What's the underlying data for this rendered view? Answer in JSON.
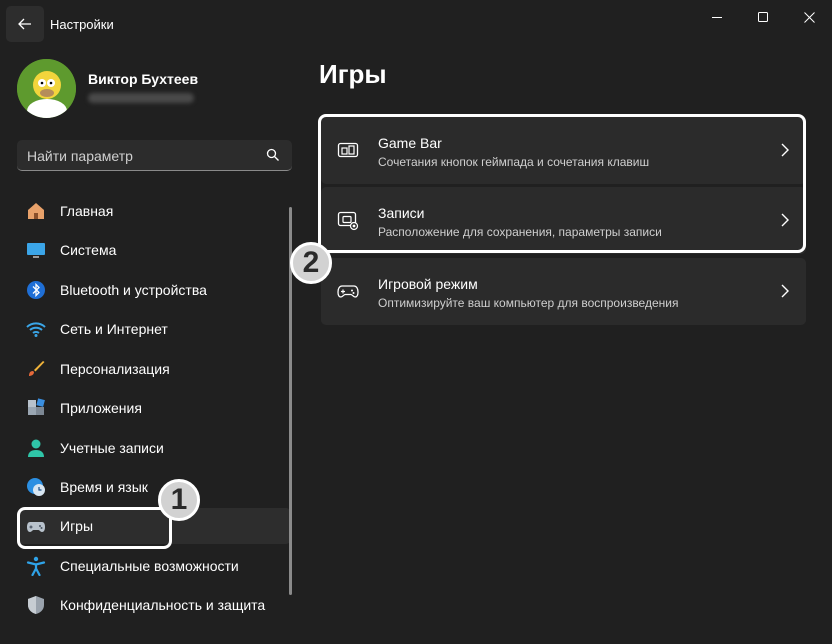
{
  "window": {
    "title": "Настройки"
  },
  "profile": {
    "name": "Виктор Бухтеев"
  },
  "search": {
    "placeholder": "Найти параметр"
  },
  "sidebar": {
    "items": [
      {
        "label": "Главная",
        "icon": "home-icon"
      },
      {
        "label": "Система",
        "icon": "monitor-icon"
      },
      {
        "label": "Bluetooth и устройства",
        "icon": "bluetooth-icon"
      },
      {
        "label": "Сеть и Интернет",
        "icon": "wifi-icon"
      },
      {
        "label": "Персонализация",
        "icon": "brush-icon"
      },
      {
        "label": "Приложения",
        "icon": "apps-icon"
      },
      {
        "label": "Учетные записи",
        "icon": "person-icon"
      },
      {
        "label": "Время и язык",
        "icon": "globe-clock-icon"
      },
      {
        "label": "Игры",
        "icon": "gamepad-icon",
        "selected": true
      },
      {
        "label": "Специальные возможности",
        "icon": "accessibility-icon"
      },
      {
        "label": "Конфиденциальность и защита",
        "icon": "shield-icon"
      }
    ]
  },
  "main": {
    "title": "Игры",
    "cards": [
      {
        "title": "Game Bar",
        "subtitle": "Сочетания кнопок геймпада и сочетания клавиш",
        "icon": "game-bar-icon"
      },
      {
        "title": "Записи",
        "subtitle": "Расположение для сохранения, параметры записи",
        "icon": "capture-icon"
      },
      {
        "title": "Игровой режим",
        "subtitle": "Оптимизируйте ваш компьютер для воспроизведения",
        "icon": "gamepad-icon"
      }
    ]
  },
  "annotations": {
    "badge1": "1",
    "badge2": "2"
  },
  "colors": {
    "background": "#202020",
    "card": "#2b2b2b",
    "selected": "#2d2d2d",
    "highlight": "#ffffff"
  }
}
